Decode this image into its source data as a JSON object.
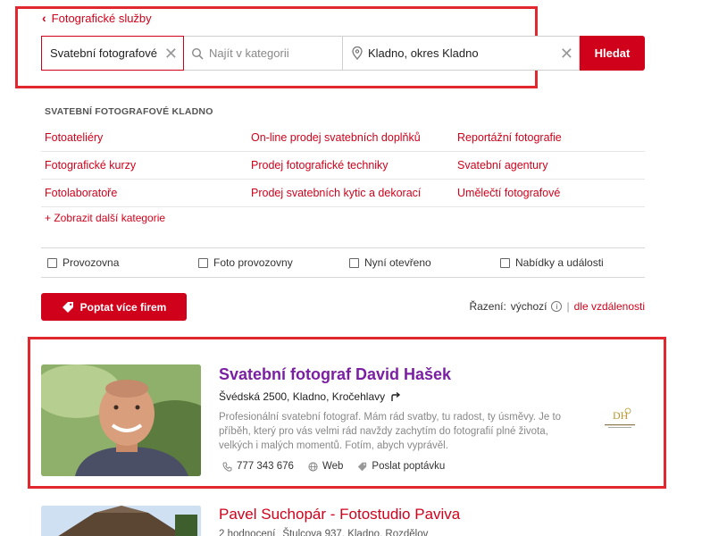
{
  "breadcrumb": {
    "back_label": "Fotografické služby"
  },
  "search": {
    "category_value": "Svatební fotografové",
    "keyword_placeholder": "Najít v kategorii",
    "location_value": "Kladno, okres Kladno",
    "button_label": "Hledat"
  },
  "categories": {
    "heading": "SVATEBNÍ FOTOGRAFOVÉ KLADNO",
    "rows": [
      [
        "Fotoateliéry",
        "On-line prodej svatebních doplňků",
        "Reportážní fotografie"
      ],
      [
        "Fotografické kurzy",
        "Prodej fotografické techniky",
        "Svatební agentury"
      ],
      [
        "Fotolaboratoře",
        "Prodej svatebních kytic a dekorací",
        "Umělečtí fotografové"
      ]
    ],
    "more_label": "+ Zobrazit další kategorie"
  },
  "filters": [
    "Provozovna",
    "Foto provozovny",
    "Nyní otevřeno",
    "Nabídky a události"
  ],
  "actions": {
    "ask_more_label": "Poptat více firem"
  },
  "sort": {
    "label": "Řazení:",
    "active": "výchozí",
    "separator": "|",
    "alt": "dle vzdálenosti"
  },
  "results": [
    {
      "title": "Svatební fotograf David Hašek",
      "address": "Švédská 2500, Kladno, Kročehlavy",
      "description": "Profesionální svatební fotograf. Mám rád svatby, tu radost, ty úsměvy. Je to příběh, který pro vás velmi rád navždy zachytím do fotografií plné života, velkých i malých momentů. Fotím, abych vyprávěl.",
      "phone": "777 343 676",
      "web_label": "Web",
      "request_label": "Poslat poptávku"
    },
    {
      "title": "Pavel Suchopár - Fotostudio Paviva",
      "rating_label": "2 hodnocení",
      "address": "Štulcova 937, Kladno, Rozdělov"
    }
  ],
  "colors": {
    "accent": "#d0021b",
    "title_visited": "#7b1fa2",
    "highlight_box": "#e0282e"
  }
}
